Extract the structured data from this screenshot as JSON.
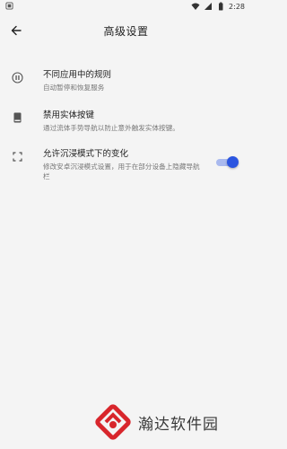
{
  "status_bar": {
    "time": "2:28",
    "icons": [
      "wifi-icon",
      "signal-icon",
      "battery-icon"
    ]
  },
  "app_bar": {
    "back_icon": "arrow-back-icon",
    "title": "高级设置"
  },
  "settings": [
    {
      "icon": "pause-circle-icon",
      "label": "不同应用中的规则",
      "description": "自动暂停和恢复服务"
    },
    {
      "icon": "phone-device-icon",
      "label": "禁用实体按键",
      "description": "通过流体手势导航以防止意外触发实体按键。"
    },
    {
      "icon": "fullscreen-icon",
      "label": "允许沉浸模式下的变化",
      "description": "修改安卓沉浸模式设置，用于在部分设备上隐藏导航栏",
      "toggle": true
    }
  ],
  "colors": {
    "background": "#f4f4f4",
    "toggle_thumb": "#2b55e0",
    "toggle_track": "#a9b9ee",
    "watermark_red": "#d8262c"
  },
  "watermark": {
    "text": "瀚达软件园"
  }
}
